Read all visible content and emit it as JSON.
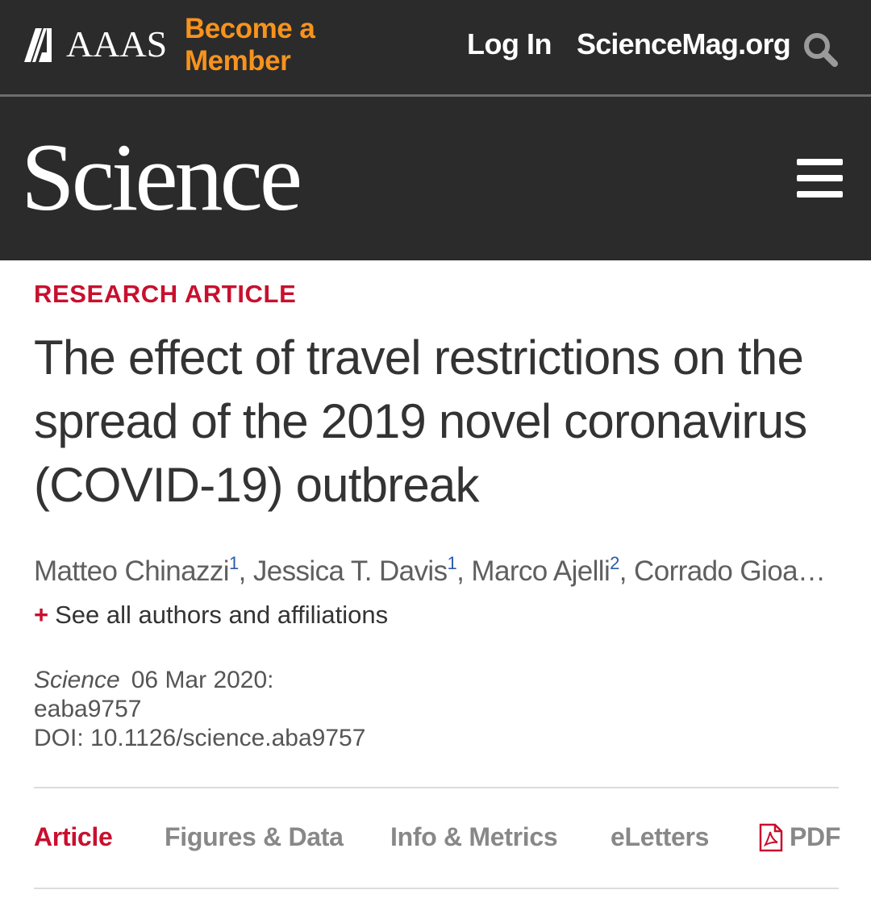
{
  "header": {
    "brand": "AAAS",
    "become_member": "Become a Member",
    "login": "Log In",
    "site_link": "ScienceMag.org",
    "search_icon": "search-icon"
  },
  "masthead": {
    "wordmark": "Science",
    "menu_icon": "hamburger-menu-icon"
  },
  "article": {
    "kicker": "RESEARCH ARTICLE",
    "title": "The effect of travel restrictions on the spread of the 2019 novel coronavirus (COVID-19) outbreak",
    "authors": [
      {
        "name": "Matteo Chinazzi",
        "affiliation": "1"
      },
      {
        "name": "Jessica T. Davis",
        "affiliation": "1"
      },
      {
        "name": "Marco Ajelli",
        "affiliation": "2"
      },
      {
        "name": "Corrado Gioa…",
        "affiliation": ""
      }
    ],
    "author_separator": ", ",
    "see_all_plus": "+",
    "see_all": "See all authors and affiliations",
    "journal": "Science",
    "date": "06 Mar 2020:",
    "article_id": "eaba9757",
    "doi": "DOI: 10.1126/science.aba9757"
  },
  "tabs": [
    {
      "label": "Article",
      "active": true
    },
    {
      "label": "Figures & Data",
      "active": false
    },
    {
      "label": "Info & Metrics",
      "active": false
    },
    {
      "label": "eLetters",
      "active": false
    },
    {
      "label": "PDF",
      "active": false,
      "icon": "pdf-icon"
    }
  ],
  "colors": {
    "header_bg": "#2b2b2b",
    "accent_orange": "#f7931d",
    "accent_red": "#c8102e",
    "title_text": "#333333",
    "muted_text": "#888888",
    "affiliation_blue": "#2a5ba8"
  }
}
